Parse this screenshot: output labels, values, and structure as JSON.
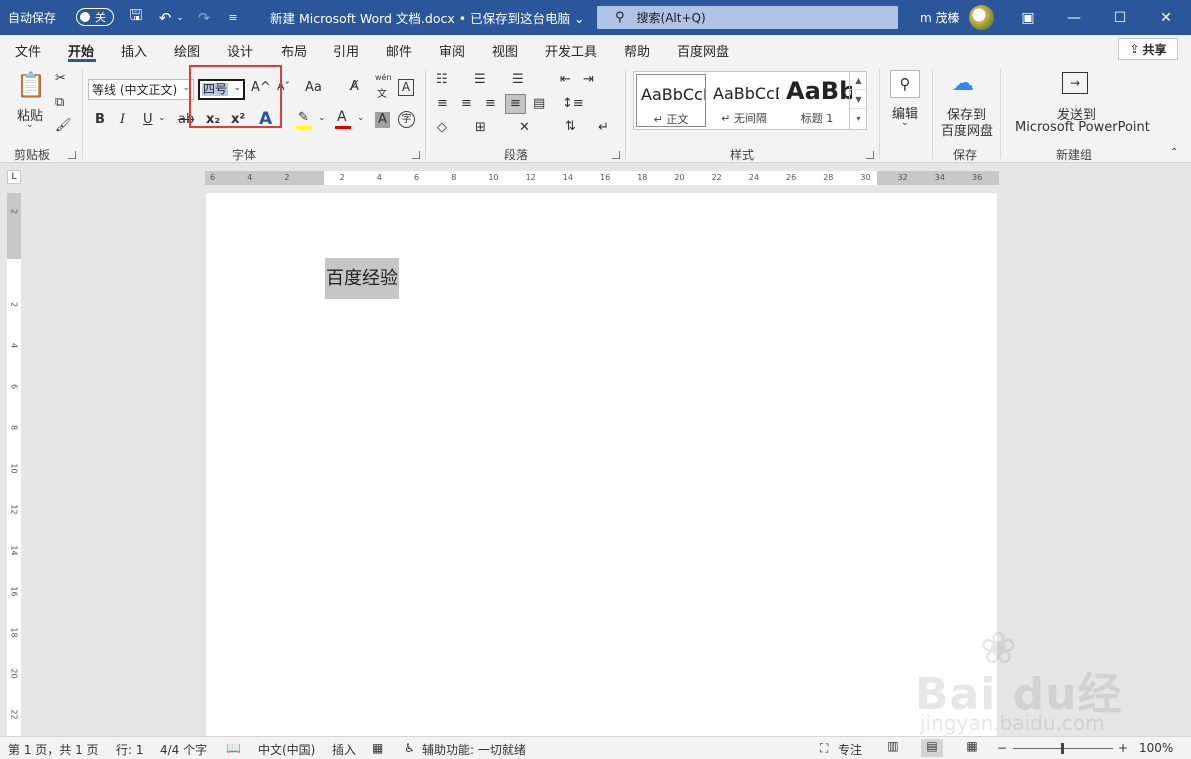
{
  "titlebar": {
    "autosave_label": "自动保存",
    "autosave_state": "关",
    "title": "新建 Microsoft Word 文档.docx • 已保存到这台电脑 ⌄",
    "search_placeholder": "搜索(Alt+Q)",
    "user_name": "m 茂榛"
  },
  "tabs": [
    "文件",
    "开始",
    "插入",
    "绘图",
    "设计",
    "布局",
    "引用",
    "邮件",
    "审阅",
    "视图",
    "开发工具",
    "帮助",
    "百度网盘"
  ],
  "share_label": "共享",
  "ribbon": {
    "clipboard": {
      "paste_label": "粘贴",
      "group_label": "剪贴板"
    },
    "font": {
      "font_name": "等线 (中文正文)",
      "font_size": "四号",
      "grow": "A^",
      "shrink": "Aˇ",
      "change_case": "Aa",
      "phonetic_top": "wén",
      "phonetic_bottom": "文",
      "bold": "B",
      "italic": "I",
      "underline": "U",
      "strike": "ab",
      "subscript": "x₂",
      "superscript": "x²",
      "text_effect": "A",
      "highlight": "✎",
      "font_color": "A",
      "shading": "A",
      "enclose": "字",
      "highlight_color": "#ffff00",
      "font_color_value": "#e00000",
      "group_label": "字体"
    },
    "paragraph": {
      "group_label": "段落"
    },
    "styles": {
      "items": [
        {
          "sample": "AaBbCcDd",
          "name": "↵ 正文"
        },
        {
          "sample": "AaBbCcDd",
          "name": "↵ 无间隔"
        },
        {
          "sample": "AaBb",
          "name": "标题 1"
        }
      ],
      "group_label": "样式"
    },
    "editing": {
      "label": "编辑"
    },
    "save": {
      "line1": "保存到",
      "line2": "百度网盘",
      "group_label": "保存"
    },
    "newgroup": {
      "line1": "发送到",
      "line2": "Microsoft PowerPoint",
      "group_label": "新建组"
    }
  },
  "ruler": {
    "h_ticks": [
      "6",
      "4",
      "2",
      "2",
      "4",
      "6",
      "8",
      "10",
      "12",
      "14",
      "16",
      "18",
      "20",
      "22",
      "24",
      "26",
      "28",
      "30",
      "32",
      "34",
      "36"
    ],
    "v_ticks": [
      "2",
      "2",
      "4",
      "6",
      "8",
      "10",
      "12",
      "14",
      "16",
      "18",
      "20",
      "22"
    ],
    "corner": "L"
  },
  "document": {
    "text": "百度经验"
  },
  "watermark": {
    "brand": "Bai du经验",
    "sub": "jingyan.baidu.com"
  },
  "status": {
    "page": "第 1 页，共 1 页",
    "line": "行: 1",
    "words": "4/4 个字",
    "language": "中文(中国)",
    "insert": "插入",
    "accessibility": "辅助功能: 一切就绪",
    "focus": "专注",
    "zoom": "100%",
    "zoom_minus": "−",
    "zoom_plus": "+"
  }
}
